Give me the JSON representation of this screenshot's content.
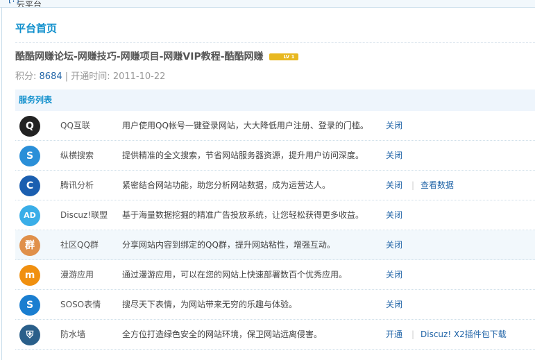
{
  "breadcrumb": {
    "text": "Discuz!云平台 » 平台首页",
    "help": "[?]"
  },
  "page_title": "平台首页",
  "site": {
    "name": "酷酷网赚论坛-网赚技巧-网赚项目-网赚VIP教程-酷酷网赚",
    "level": "LV 1"
  },
  "stats": {
    "points_label": "积分:",
    "points": "8684",
    "sep": "|",
    "open_label": "开通时间:",
    "open_date": "2011-10-22"
  },
  "services_title": "服务列表",
  "services": [
    {
      "icon": "qq-penguin-icon",
      "glyph": "Q",
      "color": "#222",
      "name": "QQ互联",
      "desc": "用户使用QQ帐号一键登录网站，大大降低用户注册、登录的门槛。",
      "action": "关闭"
    },
    {
      "icon": "soso-search-icon",
      "glyph": "S",
      "color": "#2a8fd8",
      "name": "纵横搜索",
      "desc": "提供精准的全文搜索，节省网站服务器资源，提升用户访问深度。",
      "action": "关闭"
    },
    {
      "icon": "tencent-analytics-icon",
      "glyph": "C",
      "color": "#1b5fb0",
      "name": "腾讯分析",
      "desc": "紧密结合网站功能，助您分析网站数据，成为运营达人。",
      "action": "关闭",
      "action2": "查看数据"
    },
    {
      "icon": "ad-icon",
      "glyph": "AD",
      "color": "#3aaee8",
      "name": "Discuz!联盟",
      "desc": "基于海量数据挖掘的精准广告投放系统，让您轻松获得更多收益。",
      "action": "关闭"
    },
    {
      "icon": "community-qq-group-icon",
      "glyph": "群",
      "color": "#e0904a",
      "name": "社区QQ群",
      "desc": "分享网站内容到绑定的QQ群，提升网站粘性，增强互动。",
      "action": "关闭"
    },
    {
      "icon": "manyou-icon",
      "glyph": "m",
      "color": "#f09010",
      "name": "漫游应用",
      "desc": "通过漫游应用，可以在您的网站上快速部署数百个优秀应用。",
      "action": "关闭"
    },
    {
      "icon": "soso-emoticon-icon",
      "glyph": "S",
      "color": "#1a7ed0",
      "name": "SOSO表情",
      "desc": "搜尽天下表情，为网站带来无穷的乐趣与体验。",
      "action": "关闭"
    },
    {
      "icon": "firewall-shield-icon",
      "glyph": "⛨",
      "color": "#2a5f8a",
      "name": "防水墙",
      "desc": "全方位打造绿色安全的网站环境，保卫网站远离侵害。",
      "action": "开通",
      "action2": "Discuz! X2插件包下载"
    }
  ]
}
